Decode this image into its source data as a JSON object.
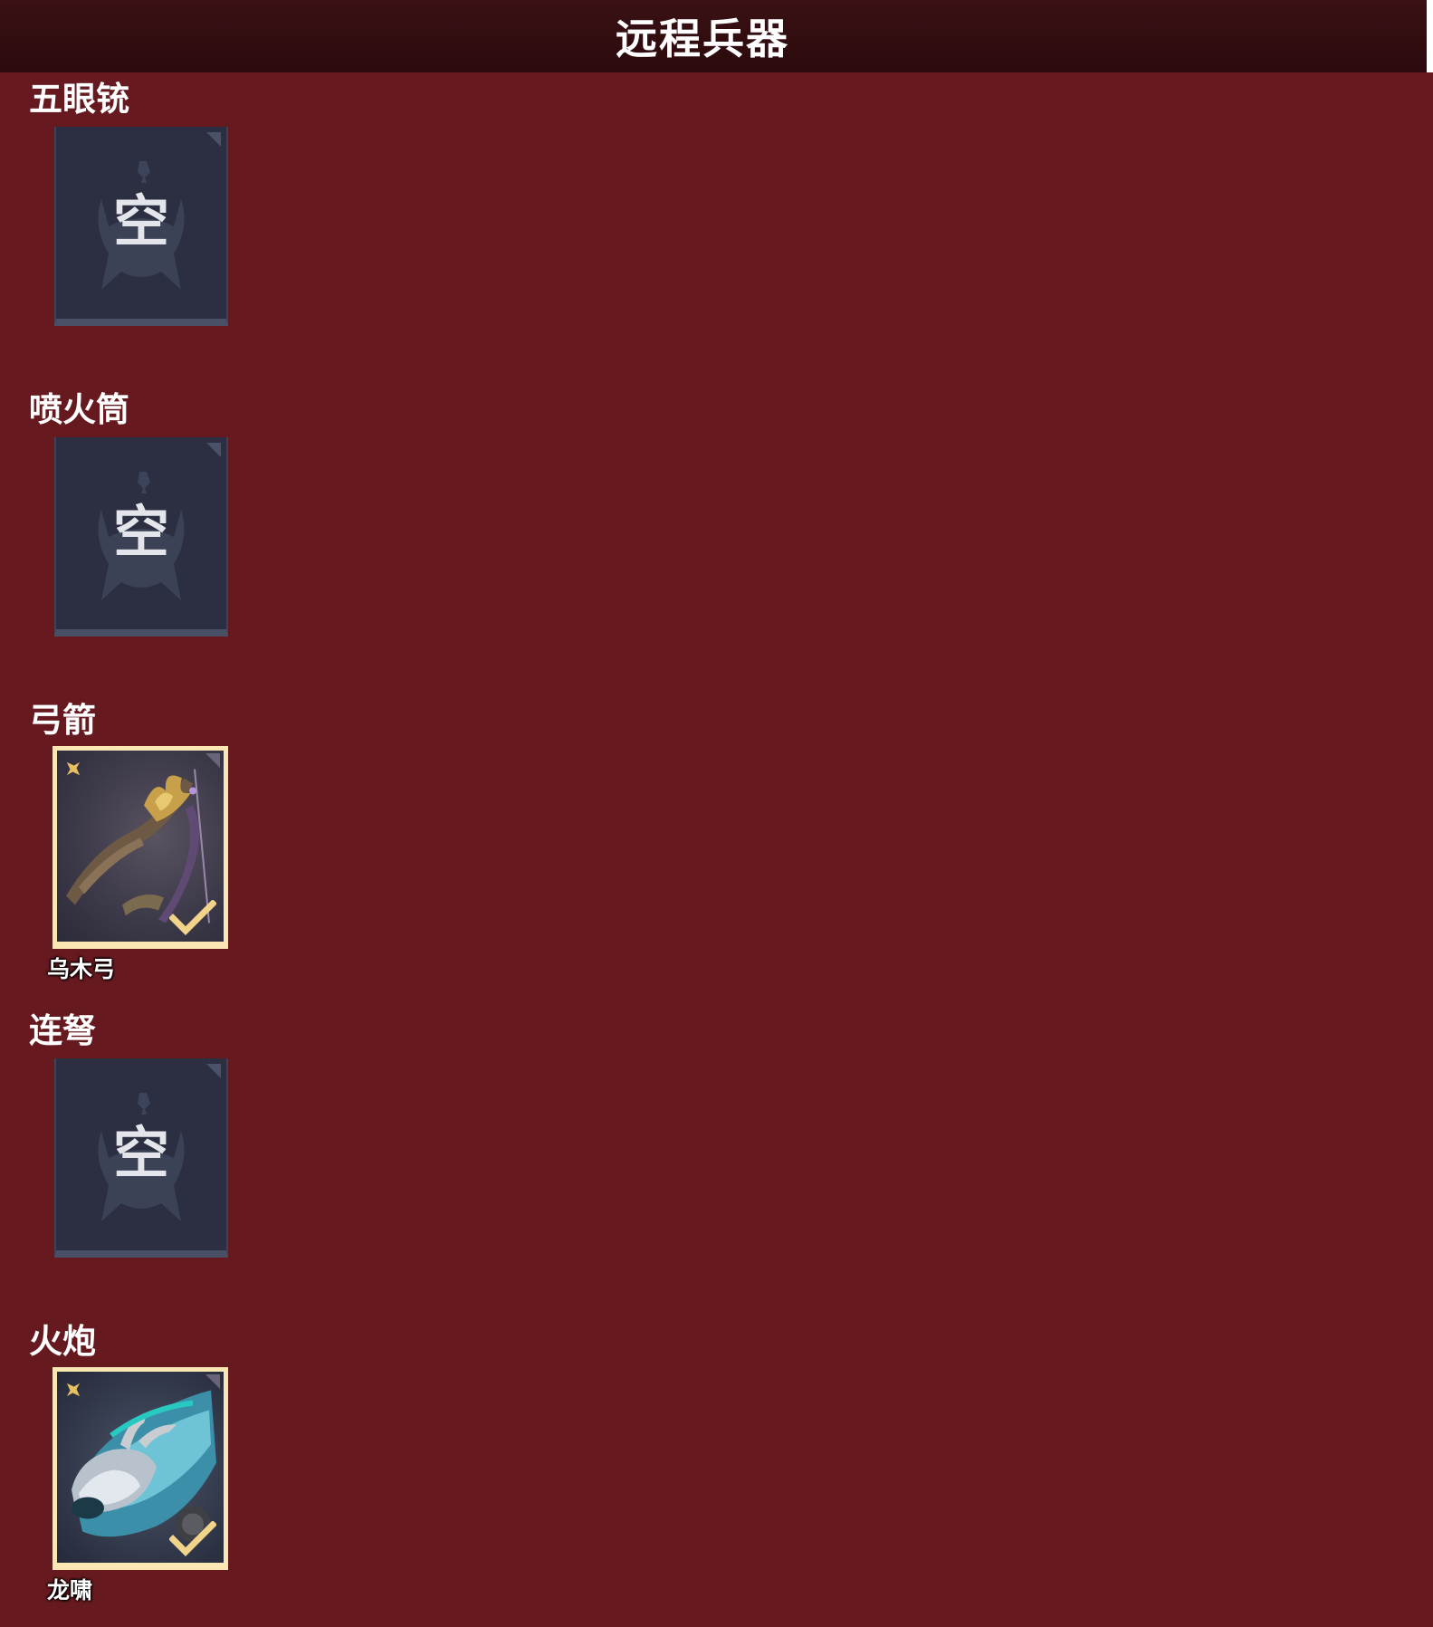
{
  "header": {
    "title": "远程兵器"
  },
  "colors": {
    "panel_bg": "#661a1f",
    "header_bg": "#2b0a0d",
    "empty_slot_bg": "#2b2f41",
    "equipped_border": "#fbe7b4"
  },
  "sections": [
    {
      "title": "五眼铳",
      "slot": {
        "state": "empty",
        "glyph": "空",
        "item_name": ""
      }
    },
    {
      "title": "喷火筒",
      "slot": {
        "state": "empty",
        "glyph": "空",
        "item_name": ""
      }
    },
    {
      "title": "弓箭",
      "slot": {
        "state": "equipped",
        "glyph": "",
        "item_name": "乌木弓",
        "icon": "bow-icon"
      }
    },
    {
      "title": "连弩",
      "slot": {
        "state": "empty",
        "glyph": "空",
        "item_name": ""
      }
    },
    {
      "title": "火炮",
      "slot": {
        "state": "equipped",
        "glyph": "",
        "item_name": "龙啸",
        "icon": "dragon-cannon-icon"
      }
    }
  ]
}
